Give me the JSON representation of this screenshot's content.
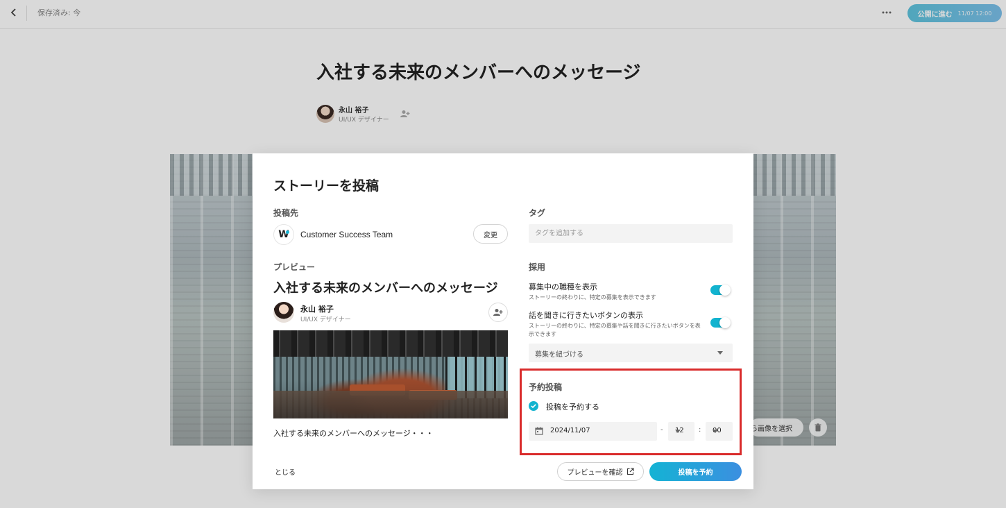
{
  "topbar": {
    "saved_status": "保存済み: 今",
    "publish_label": "公開に進む",
    "publish_time": "11/07 12:00"
  },
  "document": {
    "title": "入社する未来のメンバーへのメッセージ",
    "author_name": "永山 裕子",
    "author_role": "UI/UX デザイナー",
    "hero_select_label": "ら画像を選択"
  },
  "modal": {
    "title": "ストーリーを投稿",
    "destination": {
      "label": "投稿先",
      "team_name": "Customer Success Team",
      "team_logo": "W",
      "change_label": "変更"
    },
    "tags": {
      "label": "タグ",
      "placeholder": "タグを追加する"
    },
    "preview": {
      "label": "プレビュー",
      "title": "入社する未来のメンバーへのメッセージ",
      "author_name": "永山 裕子",
      "author_role": "UI/UX デザイナー",
      "excerpt": "入社する未来のメンバーへのメッセージ・・・"
    },
    "recruit": {
      "label": "採用",
      "toggle1_title": "募集中の職種を表示",
      "toggle1_desc": "ストーリーの終わりに、特定の募集を表示できます",
      "toggle1_on": true,
      "toggle2_title": "話を聞きに行きたいボタンの表示",
      "toggle2_desc": "ストーリーの終わりに、特定の募集や話を聞きに行きたいボタンを表示できます",
      "toggle2_on": true,
      "link_select": "募集を紐づける"
    },
    "schedule": {
      "label": "予約投稿",
      "checkbox_label": "投稿を予約する",
      "checked": true,
      "date": "2024/11/07",
      "dash": "-",
      "hour": "12",
      "colon": ":",
      "minute": "00"
    },
    "footer": {
      "close_label": "とじる",
      "preview_label": "プレビューを確認",
      "submit_label": "投稿を予約"
    }
  },
  "colors": {
    "accent": "#12b3cf",
    "highlight_border": "#d92b2b",
    "submit_gradient_end": "#3b8fe0"
  }
}
